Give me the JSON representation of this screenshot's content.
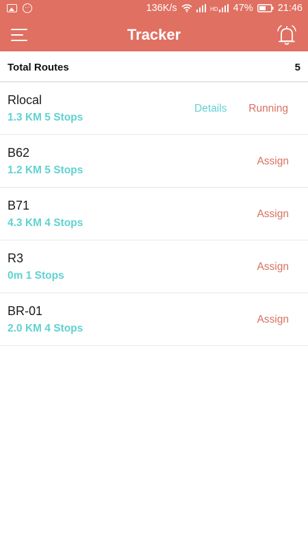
{
  "status_bar": {
    "speed": "136K/s",
    "battery": "47%",
    "time": "21:46"
  },
  "header": {
    "title": "Tracker",
    "menu_icon": "hamburger-menu-icon",
    "alarm_icon": "alarm-bell-icon",
    "color": "#e07062"
  },
  "summary": {
    "label": "Total Routes",
    "count": "5"
  },
  "routes": [
    {
      "name": "Rlocal",
      "meta": "1.3 KM 5 Stops",
      "details": "Details",
      "action": "Running"
    },
    {
      "name": "B62",
      "meta": "1.2 KM 5 Stops",
      "details": "",
      "action": "Assign"
    },
    {
      "name": "B71",
      "meta": "4.3 KM 4 Stops",
      "details": "",
      "action": "Assign"
    },
    {
      "name": "R3",
      "meta": "0m 1 Stops",
      "details": "",
      "action": "Assign"
    },
    {
      "name": "BR-01",
      "meta": "2.0 KM 4 Stops",
      "details": "",
      "action": "Assign"
    }
  ],
  "colors": {
    "accent": "#e07062",
    "teal": "#5fd2d0",
    "action": "#d9705f"
  }
}
